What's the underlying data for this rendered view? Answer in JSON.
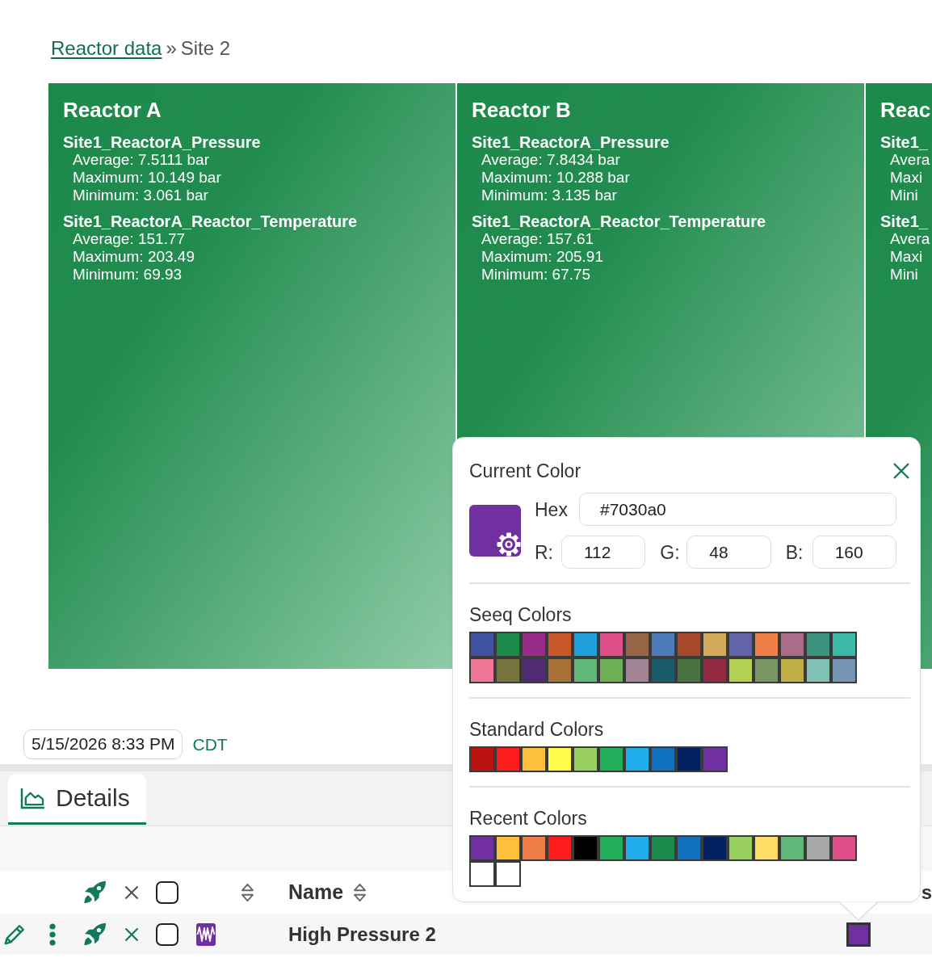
{
  "breadcrumb": {
    "link": "Reactor data",
    "separator": "»",
    "current": "Site 2"
  },
  "treemap": {
    "tiles": [
      {
        "title": "Reactor A",
        "series": [
          {
            "name": "Site1_ReactorA_Pressure",
            "stats": [
              "Average: 7.5111 bar",
              "Maximum: 10.149 bar",
              "Minimum: 3.061 bar"
            ]
          },
          {
            "name": "Site1_ReactorA_Reactor_Temperature",
            "stats": [
              "Average: 151.77",
              "Maximum: 203.49",
              "Minimum: 69.93"
            ]
          }
        ]
      },
      {
        "title": "Reactor B",
        "series": [
          {
            "name": "Site1_ReactorA_Pressure",
            "stats": [
              "Average: 7.8434 bar",
              "Maximum: 10.288 bar",
              "Minimum: 3.135 bar"
            ]
          },
          {
            "name": "Site1_ReactorA_Reactor_Temperature",
            "stats": [
              "Average: 157.61",
              "Maximum: 205.91",
              "Minimum: 67.75"
            ]
          }
        ]
      },
      {
        "title": "Reac",
        "series": [
          {
            "name": "Site1_",
            "stats": [
              "Avera",
              "Maxi",
              "Mini"
            ]
          },
          {
            "name": "Site1_",
            "stats": [
              "Avera",
              "Maxi",
              "Mini"
            ]
          }
        ]
      }
    ]
  },
  "timestamp": {
    "value": "5/15/2026 8:33 PM",
    "timezone": "CDT"
  },
  "details": {
    "tabs": [
      {
        "label": "Details",
        "selected": true
      }
    ],
    "table": {
      "header": {
        "checked": false,
        "columns": [
          {
            "label": "Name",
            "sortable": true
          },
          {
            "label": "s",
            "sortable": false
          }
        ]
      },
      "rows": [
        {
          "name": "High Pressure 2",
          "checked": false,
          "color": "#7030a0"
        }
      ]
    }
  },
  "color_picker": {
    "title": "Current Color",
    "hex": {
      "label": "Hex",
      "value": "#7030a0"
    },
    "rgb": [
      {
        "label": "R:",
        "value": "112"
      },
      {
        "label": "G:",
        "value": "48"
      },
      {
        "label": "B:",
        "value": "160"
      }
    ],
    "palettes": [
      {
        "title": "Seeq Colors",
        "swatches": [
          {
            "color": "#3f51a0"
          },
          {
            "color": "#1b8a4a"
          },
          {
            "color": "#982a8a"
          },
          {
            "color": "#c9572a"
          },
          {
            "color": "#1fa0db"
          },
          {
            "color": "#df4f8a"
          },
          {
            "color": "#976547"
          },
          {
            "color": "#4d7ab8"
          },
          {
            "color": "#a8482b"
          },
          {
            "color": "#d2aa5a"
          },
          {
            "color": "#6363a8"
          },
          {
            "color": "#ef7d47"
          },
          {
            "color": "#ab6c8a"
          },
          {
            "color": "#3b9380"
          },
          {
            "color": "#3bb8a8"
          },
          {
            "color": "#ef7697"
          },
          {
            "color": "#76733f"
          },
          {
            "color": "#512a74"
          },
          {
            "color": "#a87237"
          },
          {
            "color": "#5fb878"
          },
          {
            "color": "#6eae55"
          },
          {
            "color": "#a28396"
          },
          {
            "color": "#185b6b"
          },
          {
            "color": "#4a7240"
          },
          {
            "color": "#942a41"
          },
          {
            "color": "#b2d051"
          },
          {
            "color": "#7b9665"
          },
          {
            "color": "#beae44"
          },
          {
            "color": "#7fc1b5"
          },
          {
            "color": "#7596b4"
          }
        ]
      },
      {
        "title": "Standard Colors",
        "swatches": [
          {
            "color": "#bb1212"
          },
          {
            "color": "#fd1c1c"
          },
          {
            "color": "#fdc03a"
          },
          {
            "color": "#fefe4a"
          },
          {
            "color": "#98d160"
          },
          {
            "color": "#22ae58"
          },
          {
            "color": "#20adeb"
          },
          {
            "color": "#1070be"
          },
          {
            "color": "#03215e"
          },
          {
            "color": "#7030a0"
          }
        ]
      },
      {
        "title": "Recent Colors",
        "swatches": [
          {
            "color": "#7030a0"
          },
          {
            "color": "#fdc03a"
          },
          {
            "color": "#ef7d47"
          },
          {
            "color": "#fd1c1c"
          },
          {
            "color": "#000000"
          },
          {
            "color": "#22ae58"
          },
          {
            "color": "#20adeb"
          },
          {
            "color": "#1b8a4a"
          },
          {
            "color": "#1070be"
          },
          {
            "color": "#03215e"
          },
          {
            "color": "#98d160"
          },
          {
            "color": "#fddd66"
          },
          {
            "color": "#5fb878"
          },
          {
            "color": "#a8a8a8"
          },
          {
            "color": "#df4f8a"
          },
          {
            "color": "#ffffff"
          },
          {
            "color": "#ffffff"
          }
        ]
      }
    ]
  }
}
